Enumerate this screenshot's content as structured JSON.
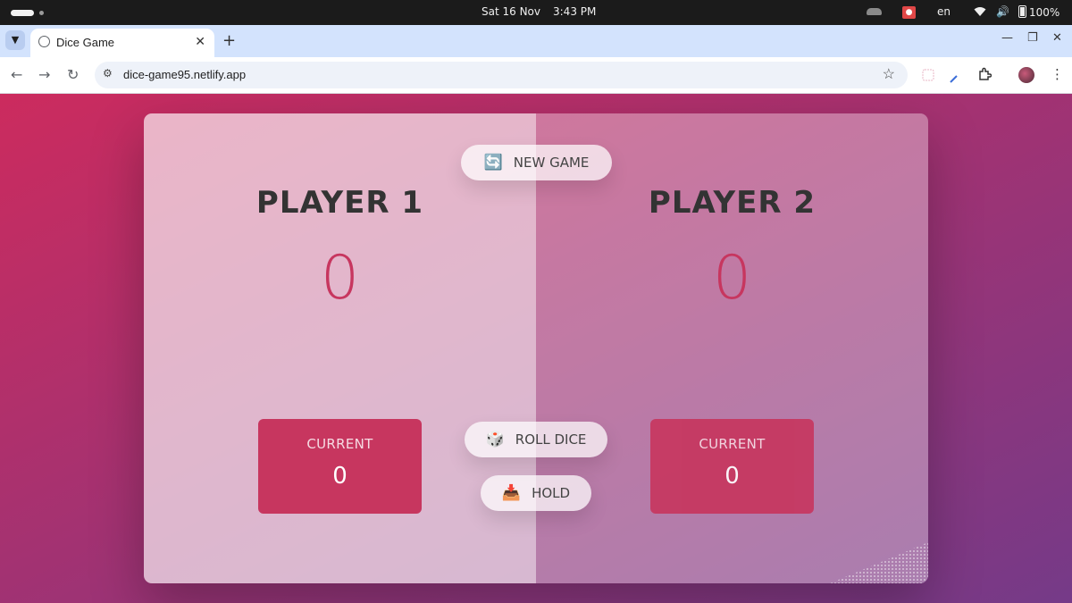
{
  "os_bar": {
    "date": "Sat 16 Nov",
    "time": "3:43 PM",
    "language": "en",
    "battery": "100%"
  },
  "browser": {
    "tab_title": "Dice Game",
    "url": "dice-game95.netlify.app"
  },
  "game": {
    "new_game_label": "NEW GAME",
    "new_game_icon": "🔄",
    "roll_label": "ROLL DICE",
    "roll_icon": "🎲",
    "hold_label": "HOLD",
    "hold_icon": "📥",
    "current_label": "CURRENT",
    "players": [
      {
        "name": "PLAYER 1",
        "score": "0",
        "current": "0",
        "active": true
      },
      {
        "name": "PLAYER 2",
        "score": "0",
        "current": "0",
        "active": false
      }
    ]
  },
  "colors": {
    "accent": "#c7365f",
    "background_start": "#cc2b5e",
    "background_end": "#753a88"
  }
}
